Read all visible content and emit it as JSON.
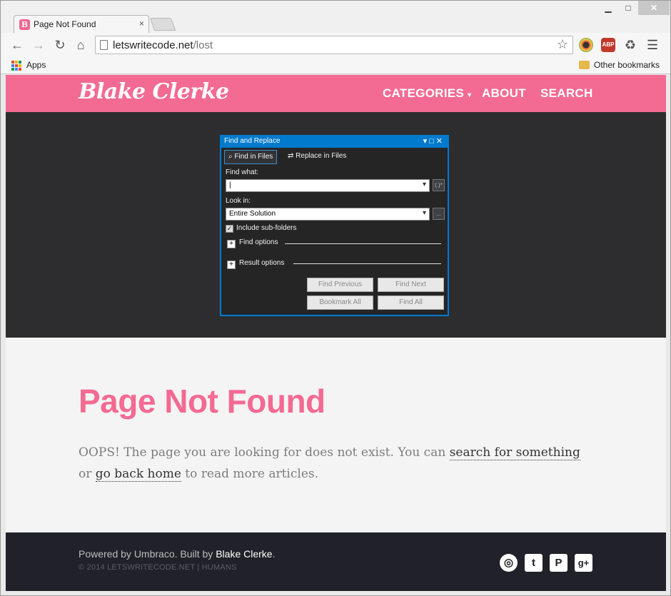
{
  "browser": {
    "tab_title": "Page Not Found",
    "tab_favicon": "B",
    "close_glyph": "×",
    "win_min": "▁",
    "win_max": "□",
    "win_close": "✕",
    "url_host": "letswritecode.net",
    "url_path": "/lost",
    "ext_abp": "ABP",
    "bookmarks": {
      "apps": "Apps",
      "other": "Other bookmarks"
    }
  },
  "site": {
    "logo": "Blake Clerke",
    "nav": {
      "categories": "CATEGORIES",
      "about": "ABOUT",
      "search": "SEARCH"
    }
  },
  "hero_dialog": {
    "title": "Find and Replace",
    "tab_find": "Find in Files",
    "tab_replace": "Replace in Files",
    "find_what_label": "Find what:",
    "find_what_value": "|",
    "regex_btn": "(.)*",
    "look_in_label": "Look in:",
    "look_in_value": "Entire Solution",
    "browse_btn": "...",
    "include_subfolders": "Include sub-folders",
    "find_options": "Find options",
    "result_options": "Result options",
    "btn_find_previous": "Find Previous",
    "btn_find_next": "Find Next",
    "btn_bookmark_all": "Bookmark All",
    "btn_find_all": "Find All"
  },
  "content": {
    "title": "Page Not Found",
    "msg_before": "OOPS! The page you are looking for does not exist. You can ",
    "link_search": "search for something",
    "msg_mid": " or ",
    "link_home": "go back home",
    "msg_after": " to read more articles."
  },
  "footer": {
    "powered": "Powered by Umbraco. Built by ",
    "author": "Blake Clerke",
    "period": ".",
    "copyright": "© 2014 LETSWRITECODE.NET | HUMANS"
  },
  "colors": {
    "brand_pink": "#f36a92",
    "hero_bg": "#2d2d30",
    "footer_bg": "#212129",
    "vs_blue": "#007acc"
  }
}
